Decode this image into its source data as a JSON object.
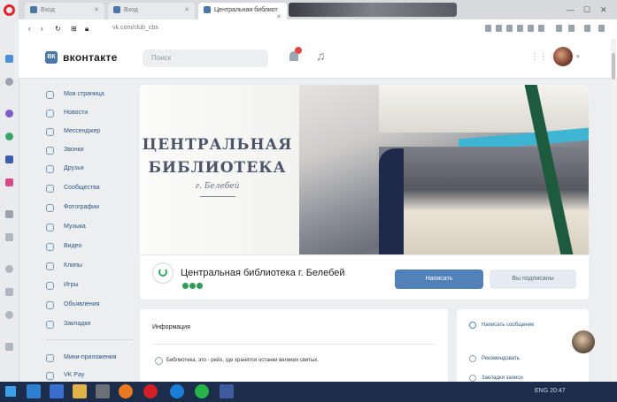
{
  "browser": {
    "tabs": [
      {
        "label": "Вход",
        "active": false
      },
      {
        "label": "Вход",
        "active": false
      },
      {
        "label": "Центральная библиот",
        "active": true
      }
    ],
    "url": "vk.com/club_cbs"
  },
  "vk": {
    "logo_text": "ВК",
    "brand": "вконтакте",
    "search_placeholder": "Поиск",
    "accent": "#4a76a8"
  },
  "sidebar": {
    "items": [
      {
        "label": "Моя страница",
        "icon": "home-icon"
      },
      {
        "label": "Новости",
        "icon": "news-icon"
      },
      {
        "label": "Мессенджер",
        "icon": "chat-icon"
      },
      {
        "label": "Звонки",
        "icon": "phone-icon"
      },
      {
        "label": "Друзья",
        "icon": "friends-icon"
      },
      {
        "label": "Сообщества",
        "icon": "groups-icon"
      },
      {
        "label": "Фотографии",
        "icon": "photo-icon"
      },
      {
        "label": "Музыка",
        "icon": "music-icon"
      },
      {
        "label": "Видео",
        "icon": "video-icon"
      },
      {
        "label": "Клипы",
        "icon": "clips-icon"
      },
      {
        "label": "Игры",
        "icon": "games-icon"
      },
      {
        "label": "Объявления",
        "icon": "ads-icon"
      },
      {
        "label": "Закладки",
        "icon": "bookmark-icon"
      }
    ],
    "bottom_items": [
      {
        "label": "Мини-приложения",
        "icon": "apps-icon"
      },
      {
        "label": "VK Pay",
        "icon": "pay-icon"
      }
    ]
  },
  "cover": {
    "line1": "ЦЕНТРАЛЬНАЯ",
    "line2": "БИБЛИОТЕКА",
    "line3": "г. Белебей"
  },
  "group": {
    "name": "Центральная библиотека г. Белебей",
    "primary_button": "Написать",
    "secondary_button": "Вы подписаны"
  },
  "info": {
    "title": "Информация",
    "text": "Библиотека, это - рейх, где хранятся останки великих святых."
  },
  "right_card": {
    "items": [
      "Написать сообщение",
      "Рекомендовать",
      "Закладки записи"
    ]
  },
  "taskbar": {
    "clock": "ENG 20:47"
  }
}
